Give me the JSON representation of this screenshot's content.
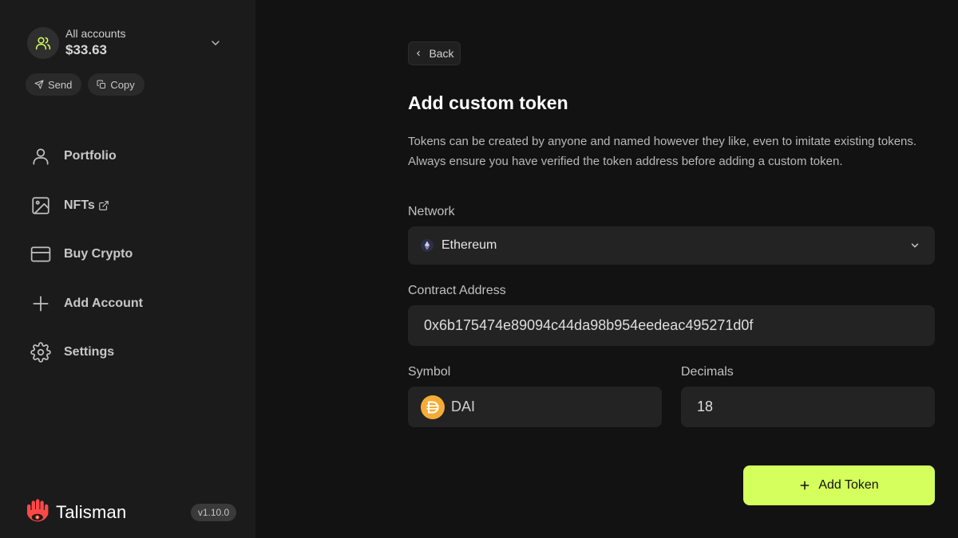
{
  "account": {
    "label": "All accounts",
    "balance": "$33.63",
    "send_label": "Send",
    "copy_label": "Copy"
  },
  "nav": {
    "items": [
      {
        "label": "Portfolio",
        "icon": "user-icon"
      },
      {
        "label": "NFTs",
        "icon": "image-icon"
      },
      {
        "label": "Buy Crypto",
        "icon": "credit-card-icon"
      },
      {
        "label": "Add Account",
        "icon": "plus-icon"
      },
      {
        "label": "Settings",
        "icon": "gear-icon"
      }
    ]
  },
  "brand": {
    "name": "Talisman",
    "version": "v1.10.0"
  },
  "page": {
    "back_label": "Back",
    "title": "Add custom token",
    "description": "Tokens can be created by anyone and named however they like, even to imitate existing tokens. Always ensure you have verified the token address before adding a custom token."
  },
  "form": {
    "network_label": "Network",
    "network_value": "Ethereum",
    "contract_label": "Contract Address",
    "contract_value": "0x6b175474e89094c44da98b954eedeac495271d0f",
    "symbol_label": "Symbol",
    "symbol_value": "DAI",
    "decimals_label": "Decimals",
    "decimals_value": "18",
    "submit_label": "Add Token"
  },
  "colors": {
    "accent": "#d5ff5c",
    "sidebar_bg": "#1b1b1b",
    "main_bg": "#121212",
    "field_bg": "#232323",
    "brand_red": "#fd4848",
    "dai_yellow": "#f5ac37"
  }
}
